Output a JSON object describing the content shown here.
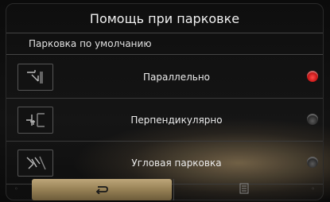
{
  "header": {
    "title": "Помощь при парковке"
  },
  "section": {
    "subtitle": "Парковка по умолчанию"
  },
  "options": [
    {
      "label": "Параллельно",
      "selected": true,
      "icon": "parallel-parking-icon"
    },
    {
      "label": "Перпендикулярно",
      "selected": false,
      "icon": "perpendicular-parking-icon"
    },
    {
      "label": "Угловая парковка",
      "selected": false,
      "icon": "angle-parking-icon"
    }
  ],
  "footer": {
    "back_icon": "back-arrow-icon",
    "menu_icon": "menu-list-icon"
  },
  "colors": {
    "selected_radio": "#d01818",
    "back_button": "#a89068"
  }
}
